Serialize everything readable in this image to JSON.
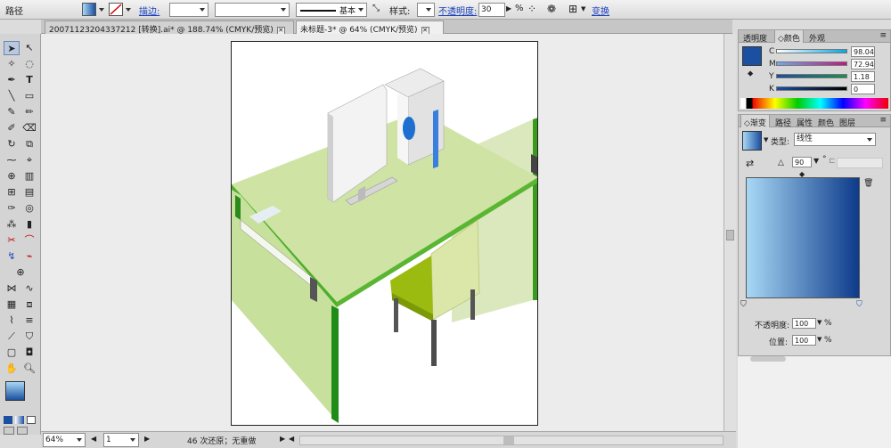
{
  "control_bar": {
    "object_type": "路径",
    "stroke_label": "描边:",
    "stroke_profile": "基本",
    "style_label": "样式:",
    "opacity_label": "不透明度:",
    "opacity_value": "30",
    "opacity_unit": "%",
    "transform_label": "变换"
  },
  "doc_tabs": [
    {
      "label": "20071123204337212 [转换].ai* @ 188.74% (CMYK/预览)"
    },
    {
      "label": "未标题-3* @ 64% (CMYK/预览)"
    }
  ],
  "color_panel": {
    "tabs": [
      "透明度",
      "颜色",
      "外观"
    ],
    "active_tab": "颜色",
    "channels": [
      {
        "label": "C",
        "value": "98.04"
      },
      {
        "label": "M",
        "value": "72.94"
      },
      {
        "label": "Y",
        "value": "1.18"
      },
      {
        "label": "K",
        "value": "0"
      }
    ],
    "fill_color": "#1b4f9f"
  },
  "gradient_panel": {
    "tabs": [
      "渐变",
      "路径",
      "属性",
      "颜色",
      "图层"
    ],
    "active_tab": "渐变",
    "type_label": "类型:",
    "type_value": "线性",
    "angle_symbol": "△",
    "angle_value": "90",
    "degree": "°",
    "opacity_label": "不透明度:",
    "opacity_value": "100",
    "location_label": "位置:",
    "location_value": "100",
    "percent": "%",
    "start_color": "#a8d8f5",
    "end_color": "#0d3a8a"
  },
  "status_bar": {
    "zoom": "64%",
    "page": "1",
    "undo_status": "46 次还原；无重做"
  },
  "colors": {
    "desk_green": "#cfe4a4",
    "desk_edge": "#4caf2a",
    "chair_seat": "#9bbb10",
    "chair_back": "#dbe7a8"
  }
}
